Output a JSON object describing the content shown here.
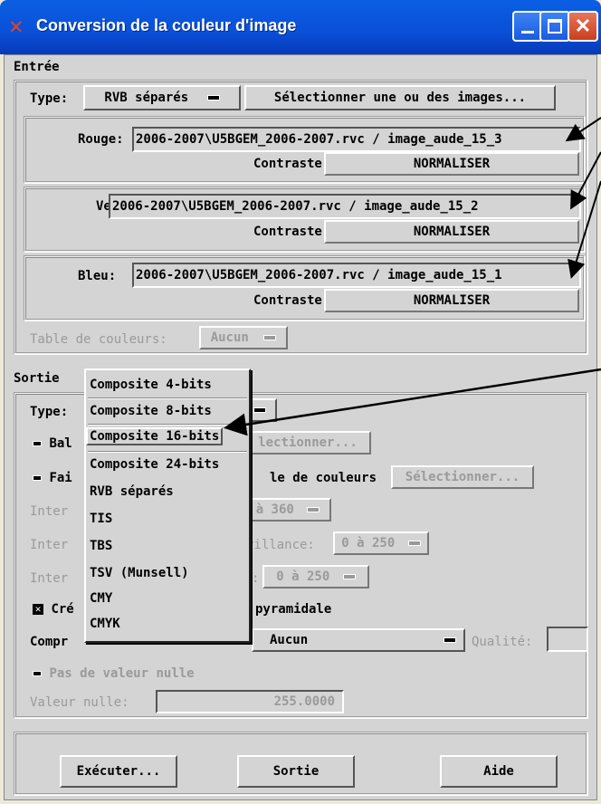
{
  "window": {
    "title": "Conversion de la couleur d'image"
  },
  "entree": {
    "heading": "Entrée",
    "type_label": "Type:",
    "type_value": "RVB séparés",
    "select_button": "Sélectionner une ou des images...",
    "channels": [
      {
        "label": "Rouge:",
        "path": "2006-2007\\U5BGEM_2006-2007.rvc / image_aude_15_3",
        "contrast_label": "Contraste:",
        "contrast_value": "NORMALISER"
      },
      {
        "label": "Vert",
        "path": "2006-2007\\U5BGEM_2006-2007.rvc / image_aude_15_2",
        "contrast_label": "Contraste:",
        "contrast_value": "NORMALISER"
      },
      {
        "label": "Bleu:",
        "path": "2006-2007\\U5BGEM_2006-2007.rvc / image_aude_15_1",
        "contrast_label": "Contraste:",
        "contrast_value": "NORMALISER"
      }
    ],
    "table_label": "Table de couleurs:",
    "table_value": "Aucun"
  },
  "sortie": {
    "heading": "Sortie",
    "type_label": "Type:",
    "bal_label": "Bal",
    "fai_label": "Fai",
    "table_couleurs_label": "le de couleurs",
    "select_button_partial": "lectionner...",
    "select_button": "Sélectionner...",
    "inter1_label": "Inter",
    "inter1_value": "à 360",
    "inter2_label": "Inter",
    "inter2_prefix": "rillance:",
    "inter2_value": "0 à 250",
    "inter3_label": "Inter",
    "inter3_prefix": ":",
    "inter3_value": "0 à 250",
    "create_label": "Cré",
    "pyramid_label": "pyramidale",
    "compress_label": "Compr",
    "compress_value": "Aucun",
    "quality_label": "Qualité:",
    "no_null_label": "Pas de valeur nulle",
    "null_value_label": "Valeur nulle:",
    "null_value": "255.0000"
  },
  "type_menu": {
    "items": [
      "Composite 4-bits",
      "Composite 8-bits",
      "Composite 16-bits",
      "Composite 24-bits",
      "RVB séparés",
      "TIS",
      "TBS",
      "TSV (Munsell)",
      "CMY",
      "CMYK"
    ],
    "selected": "Composite 16-bits"
  },
  "footer": {
    "execute": "Exécuter...",
    "exit": "Sortie",
    "help": "Aide"
  },
  "colors": {
    "titlebar": "#0a4fd8",
    "background": "#d4d4d4",
    "close_button": "#c8401c"
  }
}
